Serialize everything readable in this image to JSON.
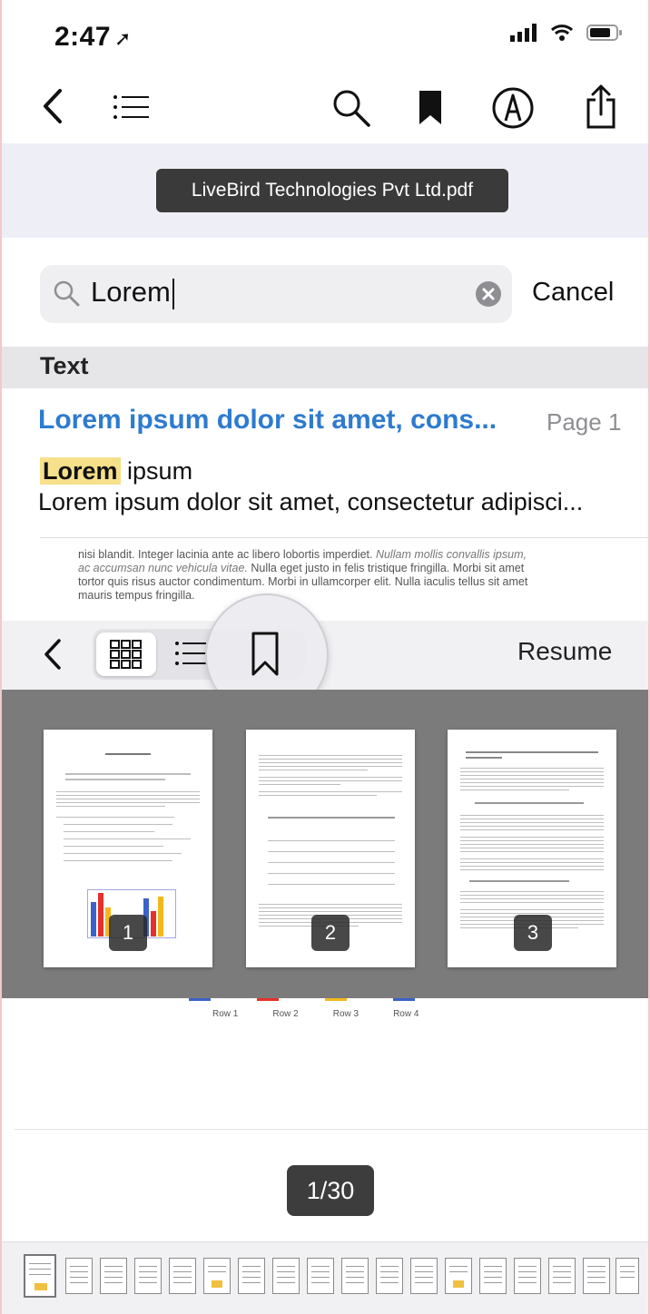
{
  "status_bar": {
    "time": "2:47",
    "location_glyph": "➚"
  },
  "toolbar": {
    "icons": [
      "back-icon",
      "list-icon",
      "search-icon",
      "bookmark-icon",
      "markup-icon",
      "share-icon"
    ]
  },
  "document": {
    "file_name": "LiveBird Technologies Pvt Ltd.pdf"
  },
  "search": {
    "query": "Lorem",
    "cancel_label": "Cancel"
  },
  "results": {
    "section_label": "Text",
    "items": [
      {
        "title": "Lorem ipsum dolor sit amet, cons...",
        "page": "Page 1",
        "match": "Lorem",
        "match_rest": " ipsum",
        "excerpt": "Lorem ipsum dolor sit amet, consectetur adipisci..."
      }
    ]
  },
  "doc_snippet": {
    "line1": "nisi blandit. Integer lacinia ante ac libero lobortis imperdiet.",
    "line1_italic": " Nullam mollis convallis ipsum,",
    "line2_italic": "ac accumsan nunc vehicula vitae.",
    "line2": " Nulla eget justo in felis tristique fringilla. Morbi sit amet",
    "line3": "tortor quis risus auctor condimentum. Morbi in ullamcorper elit. Nulla iaculis tellus sit amet",
    "line4": "mauris tempus fringilla."
  },
  "thumbnail_bar": {
    "resume_label": "Resume"
  },
  "page_thumbs": [
    "1",
    "2",
    "3"
  ],
  "chart_rows": [
    "Row 1",
    "Row 2",
    "Row 3",
    "Row 4"
  ],
  "page_counter": "1/30",
  "colors": {
    "accent_blue": "#2e7bcf",
    "highlight": "#f6e08a",
    "lavender": "#eeeef7",
    "panel_grey": "#7b7b7b"
  }
}
